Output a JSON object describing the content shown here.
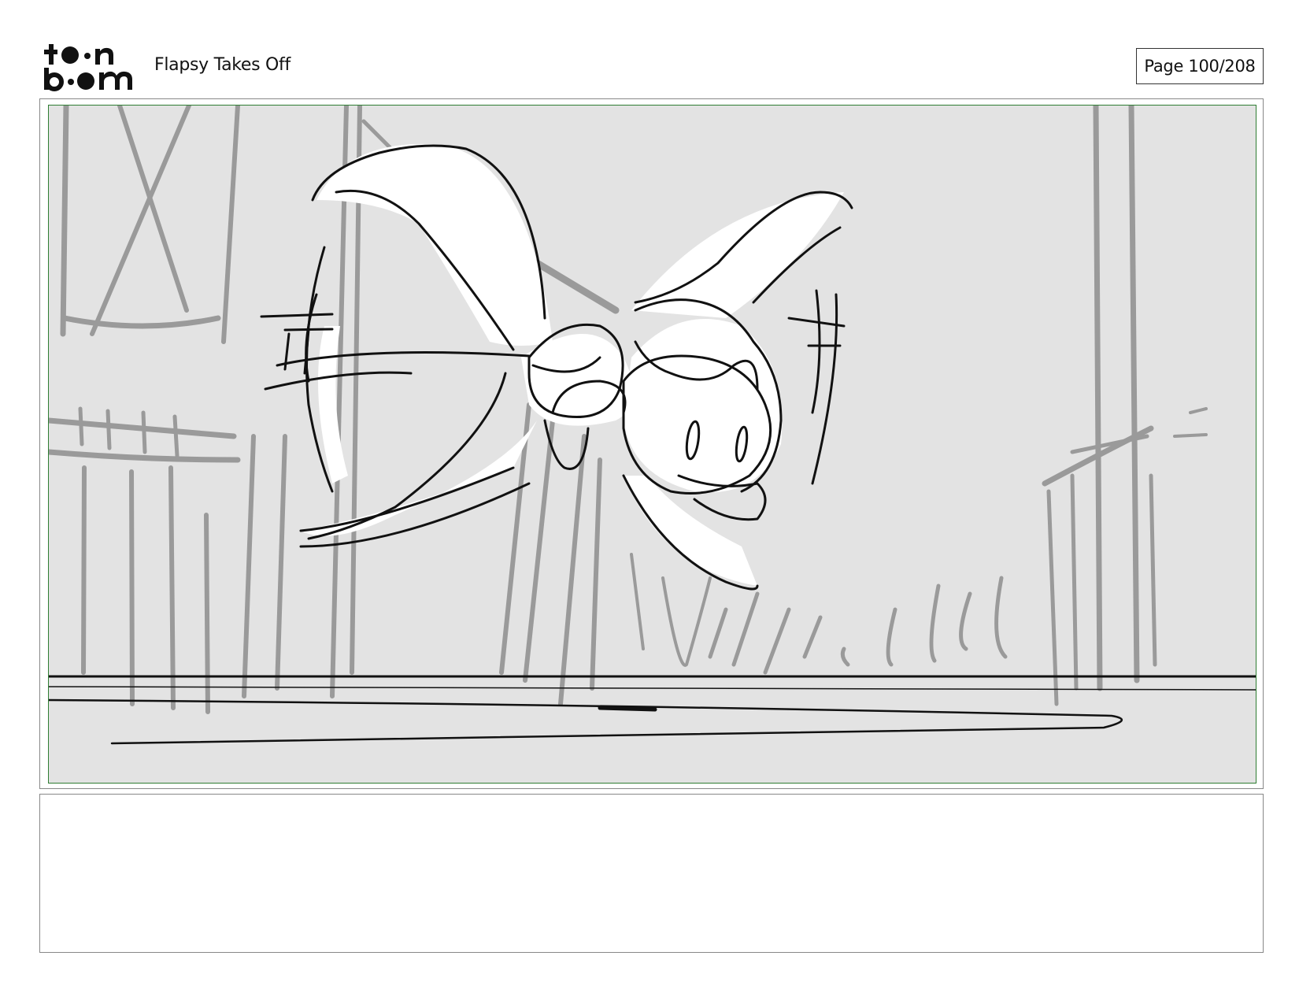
{
  "header": {
    "logo": {
      "text": "toon boom",
      "icon": "toon-boom-logo-icon"
    },
    "title": "Flapsy Takes Off",
    "page_label": "Page 100/208"
  },
  "panel": {
    "image": "storyboard-sketch-flapsy-flying",
    "frame_color": "#2e7d32",
    "background_color": "#e3e3e3"
  },
  "notes": {
    "text": ""
  }
}
